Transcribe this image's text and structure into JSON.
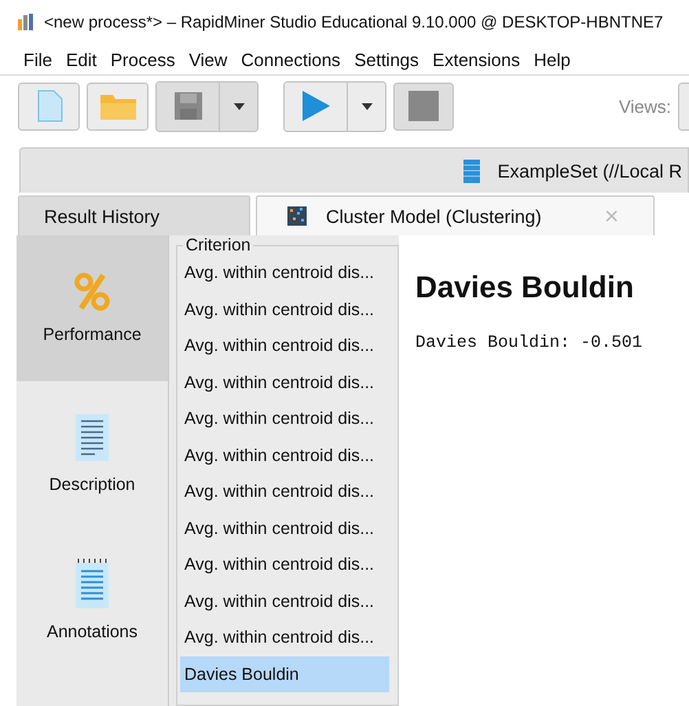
{
  "window": {
    "title": "<new process*> – RapidMiner Studio Educational 9.10.000 @ DESKTOP-HBNTNE7"
  },
  "menu": [
    "File",
    "Edit",
    "Process",
    "View",
    "Connections",
    "Settings",
    "Extensions",
    "Help"
  ],
  "toolbar": {
    "views_label": "Views:"
  },
  "tabs_top": [
    {
      "label": "ExampleSet (//Local R",
      "selected": false
    }
  ],
  "tabs": [
    {
      "label": "Result History",
      "kind": "plain",
      "selected": false
    },
    {
      "label": "Cluster Model (Clustering)",
      "kind": "closable",
      "close": "×",
      "selected": true
    }
  ],
  "side_nav": [
    {
      "label": "Performance",
      "kind": "percent",
      "selected": true
    },
    {
      "label": "Description",
      "kind": "document",
      "selected": false
    },
    {
      "label": "Annotations",
      "kind": "notepad",
      "selected": false
    }
  ],
  "criterion": {
    "title": "Criterion",
    "items": [
      {
        "label": "Avg. within centroid dis...",
        "selected": false
      },
      {
        "label": "Avg. within centroid dis...",
        "selected": false
      },
      {
        "label": "Avg. within centroid dis...",
        "selected": false
      },
      {
        "label": "Avg. within centroid dis...",
        "selected": false
      },
      {
        "label": "Avg. within centroid dis...",
        "selected": false
      },
      {
        "label": "Avg. within centroid dis...",
        "selected": false
      },
      {
        "label": "Avg. within centroid dis...",
        "selected": false
      },
      {
        "label": "Avg. within centroid dis...",
        "selected": false
      },
      {
        "label": "Avg. within centroid dis...",
        "selected": false
      },
      {
        "label": "Avg. within centroid dis...",
        "selected": false
      },
      {
        "label": "Avg. within centroid dis...",
        "selected": false
      },
      {
        "label": "Davies Bouldin",
        "selected": true
      }
    ]
  },
  "result": {
    "heading": "Davies Bouldin",
    "value": "Davies Bouldin: -0.501"
  }
}
